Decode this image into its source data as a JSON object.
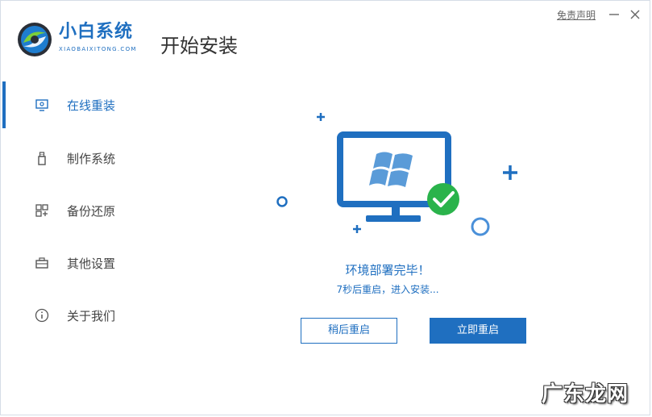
{
  "app": {
    "name_cn": "小白系统",
    "name_en": "XIAOBAIXITONG.COM",
    "page_title": "开始安装",
    "disclaimer": "免责声明"
  },
  "sidebar": {
    "items": [
      {
        "label": "在线重装",
        "icon": "monitor-icon",
        "active": true
      },
      {
        "label": "制作系统",
        "icon": "usb-drive-icon",
        "active": false
      },
      {
        "label": "备份还原",
        "icon": "grid-backup-icon",
        "active": false
      },
      {
        "label": "其他设置",
        "icon": "briefcase-icon",
        "active": false
      },
      {
        "label": "关于我们",
        "icon": "info-icon",
        "active": false
      }
    ]
  },
  "main": {
    "status": "环境部署完毕！",
    "countdown": "7秒后重启，进入安装...",
    "buttons": {
      "later": "稍后重启",
      "now": "立即重启"
    }
  },
  "watermark": "广东龙网",
  "colors": {
    "accent": "#1f6fc0",
    "success": "#2ab34b"
  }
}
